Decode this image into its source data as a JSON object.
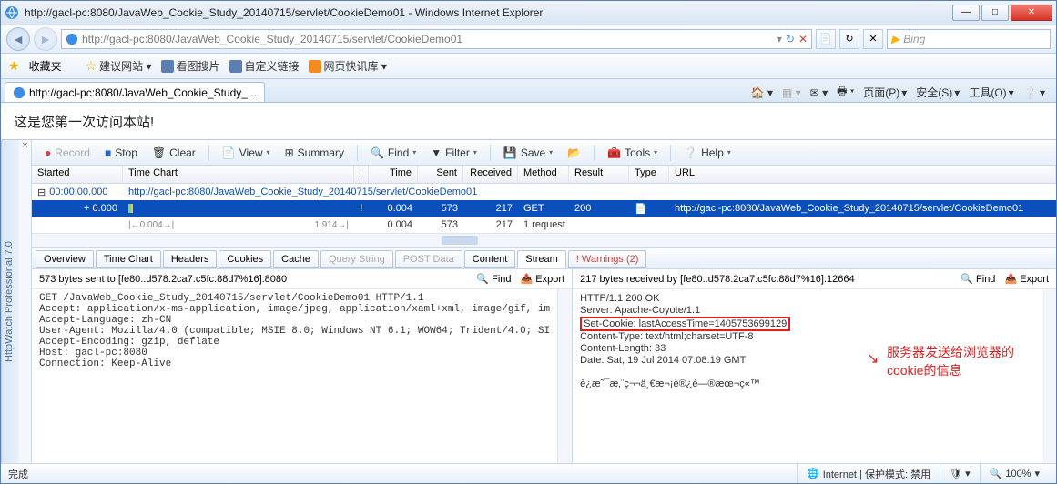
{
  "window": {
    "title": "http://gacl-pc:8080/JavaWeb_Cookie_Study_20140715/servlet/CookieDemo01 - Windows Internet Explorer"
  },
  "nav": {
    "url": "http://gacl-pc:8080/JavaWeb_Cookie_Study_20140715/servlet/CookieDemo01",
    "search_placeholder": "Bing"
  },
  "favbar": {
    "label": "收藏夹",
    "items": [
      "建议网站 ▾",
      "看图搜片",
      "自定义链接",
      "网页快讯库 ▾"
    ]
  },
  "tab": {
    "title": "http://gacl-pc:8080/JavaWeb_Cookie_Study_..."
  },
  "cmdbar": {
    "page": "页面(P)",
    "safety": "安全(S)",
    "tools": "工具(O)"
  },
  "page": {
    "body_text": "这是您第一次访问本站!"
  },
  "hw": {
    "side_label": "HttpWatch Professional 7.0",
    "toolbar": {
      "record": "Record",
      "stop": "Stop",
      "clear": "Clear",
      "view": "View",
      "summary": "Summary",
      "find": "Find",
      "filter": "Filter",
      "save": "Save",
      "tools": "Tools",
      "help": "Help"
    },
    "grid": {
      "headers": {
        "started": "Started",
        "timechart": "Time Chart",
        "bang": "!",
        "time": "Time",
        "sent": "Sent",
        "received": "Received",
        "method": "Method",
        "result": "Result",
        "type": "Type",
        "url": "URL"
      },
      "group_row": {
        "started": "00:00:00.000",
        "url": "http://gacl-pc:8080/JavaWeb_Cookie_Study_20140715/servlet/CookieDemo01"
      },
      "data_row": {
        "started": "+ 0.000",
        "bang": "!",
        "time": "0.004",
        "sent": "573",
        "recv": "217",
        "method": "GET",
        "result": "200",
        "type_icon": "page",
        "url": "http://gacl-pc:8080/JavaWeb_Cookie_Study_20140715/servlet/CookieDemo01"
      },
      "summary_row": {
        "tc_left": "0.004",
        "tc_right": "1.914",
        "time": "0.004",
        "sent": "573",
        "recv": "217",
        "method": "1 request"
      }
    },
    "tabs": [
      "Overview",
      "Time Chart",
      "Headers",
      "Cookies",
      "Cache",
      "Query String",
      "POST Data",
      "Content",
      "Stream",
      "! Warnings (2)"
    ],
    "active_tab": "Stream",
    "left_pane": {
      "head": "573 bytes sent to [fe80::d578:2ca7:c5fc:88d7%16]:8080",
      "find": "Find",
      "export": "Export",
      "body": "GET /JavaWeb_Cookie_Study_20140715/servlet/CookieDemo01 HTTP/1.1\nAccept: application/x-ms-application, image/jpeg, application/xaml+xml, image/gif, im\nAccept-Language: zh-CN\nUser-Agent: Mozilla/4.0 (compatible; MSIE 8.0; Windows NT 6.1; WOW64; Trident/4.0; SI\nAccept-Encoding: gzip, deflate\nHost: gacl-pc:8080\nConnection: Keep-Alive\n"
    },
    "right_pane": {
      "head": "217 bytes received by [fe80::d578:2ca7:c5fc:88d7%16]:12664",
      "find": "Find",
      "export": "Export",
      "body_pre": "HTTP/1.1 200 OK\nServer: Apache-Coyote/1.1\n",
      "body_hl": "Set-Cookie: lastAccessTime=1405753699129",
      "body_post": "\nContent-Type: text/html;charset=UTF-8\nContent-Length: 33\nDate: Sat, 19 Jul 2014 07:08:19 GMT\n\nè¿æ˜¯æ‚¨ç¬¬ä¸€æ¬¡è®¿é—®æœ¬ç«™",
      "annotation_l1": "服务器发送给浏览器的",
      "annotation_l2": "cookie的信息"
    }
  },
  "statusbar": {
    "done": "完成",
    "zone": "Internet | 保护模式: 禁用",
    "zoom": "100%"
  }
}
